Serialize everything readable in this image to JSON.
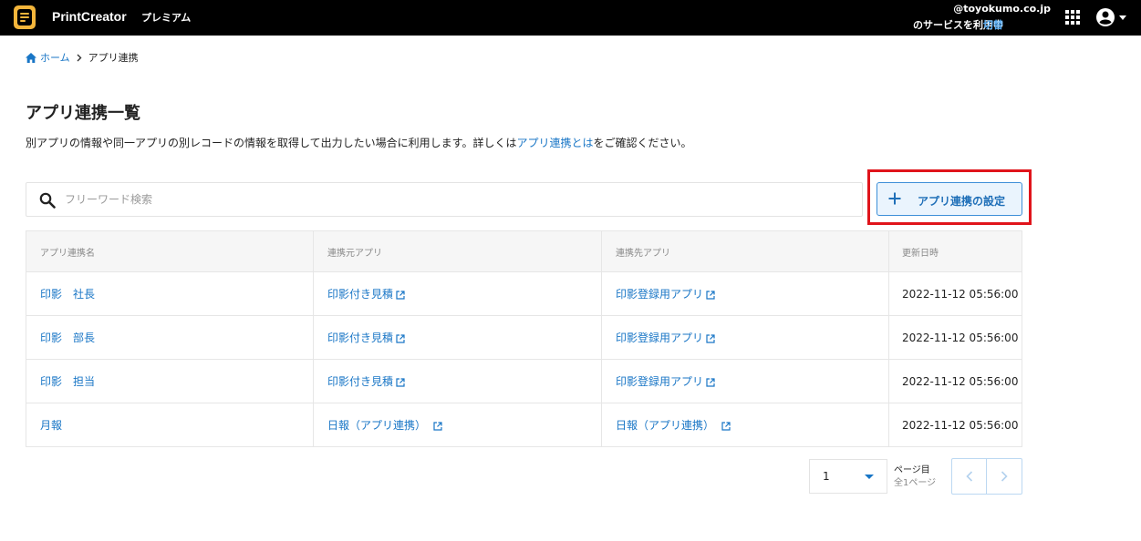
{
  "header": {
    "brand": "PrintCreator",
    "plan": "プレミアム",
    "account_email": "@toyokumo.co.jp",
    "account_service": "のサービスを利用中",
    "switch_label": "切替",
    "icons": [
      "apps-grid-icon",
      "user-account-icon",
      "caret-down-icon"
    ]
  },
  "breadcrumb": {
    "home_label": "ホーム",
    "current_label": "アプリ連携"
  },
  "page": {
    "title": "アプリ連携一覧",
    "description_before": "別アプリの情報や同一アプリの別レコードの情報を取得して出力したい場合に利用します。詳しくは",
    "description_link": "アプリ連携とは",
    "description_after": "をご確認ください。"
  },
  "search": {
    "placeholder": "フリーワード検索",
    "value": ""
  },
  "add_button": {
    "label": "アプリ連携の設定"
  },
  "table": {
    "columns": [
      "アプリ連携名",
      "連携元アプリ",
      "連携先アプリ",
      "更新日時"
    ],
    "rows": [
      {
        "name": "印影　社長",
        "source": "印影付き見積",
        "target": "印影登録用アプリ",
        "updated": "2022-11-12 05:56:00"
      },
      {
        "name": "印影　部長",
        "source": "印影付き見積",
        "target": "印影登録用アプリ",
        "updated": "2022-11-12 05:56:00"
      },
      {
        "name": "印影　担当",
        "source": "印影付き見積",
        "target": "印影登録用アプリ",
        "updated": "2022-11-12 05:56:00"
      },
      {
        "name": "月報",
        "source": "日報（アプリ連携）",
        "target": "日報（アプリ連携）",
        "updated": "2022-11-12 05:56:00"
      }
    ]
  },
  "pagination": {
    "current_page": "1",
    "page_suffix": "ページ目",
    "total_label": "全1ページ"
  },
  "colors": {
    "accent": "#1976c6",
    "highlight_border": "#e0141b",
    "logo": "#f3b53b"
  }
}
